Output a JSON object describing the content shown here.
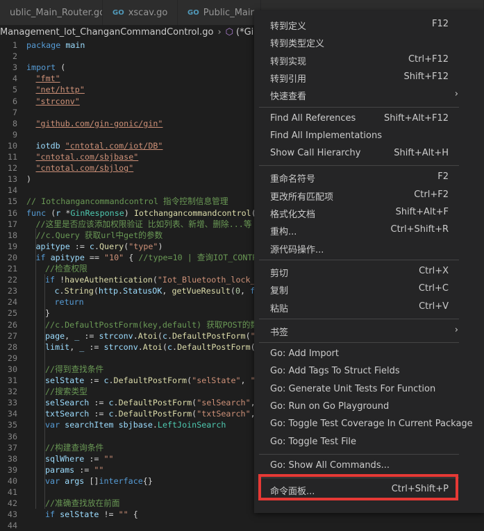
{
  "tabs": [
    {
      "name": "ublic_Main_Router.go",
      "icon": ""
    },
    {
      "name": "xscav.go",
      "icon": "GO"
    },
    {
      "name": "Public_Main_",
      "icon": "GO"
    },
    {
      "name": "",
      "icon": ""
    }
  ],
  "breadcrumb": {
    "file": "Management_lot_ChanganCommandControl.go",
    "symbol": "(*GinR"
  },
  "code_lines": [
    {
      "n": "1",
      "indent": 0,
      "html": "<span class='k'>package</span> <span class='v'>main</span>"
    },
    {
      "n": "2",
      "indent": 0,
      "html": ""
    },
    {
      "n": "3",
      "indent": 0,
      "html": "<span class='k'>import</span> ("
    },
    {
      "n": "4",
      "indent": 1,
      "html": "<span class='s ul'>\"fmt\"</span>"
    },
    {
      "n": "5",
      "indent": 1,
      "html": "<span class='s ul'>\"net/http\"</span>"
    },
    {
      "n": "6",
      "indent": 1,
      "html": "<span class='s ul'>\"strconv\"</span>"
    },
    {
      "n": "7",
      "indent": 0,
      "html": ""
    },
    {
      "n": "8",
      "indent": 1,
      "html": "<span class='s ul'>\"github.com/gin-gonic/gin\"</span>"
    },
    {
      "n": "9",
      "indent": 0,
      "html": ""
    },
    {
      "n": "10",
      "indent": 1,
      "html": "<span class='v'>iotdb</span> <span class='s ul'>\"cntotal.com/iot/DB\"</span>"
    },
    {
      "n": "11",
      "indent": 1,
      "html": "<span class='s ul'>\"cntotal.com/sbjbase\"</span>"
    },
    {
      "n": "12",
      "indent": 1,
      "html": "<span class='s ul'>\"cntotal.com/sbjlog\"</span>"
    },
    {
      "n": "13",
      "indent": 0,
      "html": ")"
    },
    {
      "n": "14",
      "indent": 0,
      "html": ""
    },
    {
      "n": "15",
      "indent": 0,
      "html": "<span class='c'>// Iotchangancommandcontrol 指令控制信息管理</span>"
    },
    {
      "n": "16",
      "indent": 0,
      "html": "<span class='k'>func</span> (<span class='v'>r</span> *<span class='t'>GinResponse</span>) <span class='f'>Iotchangancommandcontrol</span>(<span class='v'>c</span>"
    },
    {
      "n": "17",
      "indent": 1,
      "html": "<span class='c'>//这里是否应该添加权限验证 比如列表、新增、删除...等</span>"
    },
    {
      "n": "18",
      "indent": 1,
      "html": "<span class='c'>//c.Query 获取url中get的参数</span>"
    },
    {
      "n": "19",
      "indent": 1,
      "html": "<span class='v'>apitype</span> := <span class='v'>c</span>.<span class='f'>Query</span>(<span class='s'>\"type\"</span>)"
    },
    {
      "n": "20",
      "indent": 1,
      "html": "<span class='k'>if</span> <span class='v'>apitype</span> == <span class='s'>\"10\"</span> { <span class='c'>//type=10 | 查询IOT_CONTROL</span>"
    },
    {
      "n": "21",
      "indent": 2,
      "html": "<span class='c'>//检查权限</span>"
    },
    {
      "n": "22",
      "indent": 2,
      "html": "<span class='k'>if</span> !<span class='f'>haveAuthentication</span>(<span class='s'>\"Iot_Bluetooth_lock_ma</span>"
    },
    {
      "n": "23",
      "indent": 3,
      "html": "<span class='v'>c</span>.<span class='f'>String</span>(<span class='v'>http</span>.<span class='v'>StatusOK</span>, <span class='f'>getVueResult</span>(<span class='n'>0</span>, <span class='k'>fal</span>"
    },
    {
      "n": "24",
      "indent": 3,
      "html": "<span class='k'>return</span>"
    },
    {
      "n": "25",
      "indent": 2,
      "html": "}"
    },
    {
      "n": "26",
      "indent": 2,
      "html": "<span class='c'>//c.DefaultPostForm(key,default) 获取POST的数据</span>"
    },
    {
      "n": "27",
      "indent": 2,
      "html": "<span class='v'>page</span>, <span class='v'>_</span> := <span class='v'>strconv</span>.<span class='f'>Atoi</span>(<span class='v'>c</span>.<span class='f'>DefaultPostForm</span>(<span class='s'>\"pa</span>"
    },
    {
      "n": "28",
      "indent": 2,
      "html": "<span class='v'>limit</span>, <span class='v'>_</span> := <span class='v'>strconv</span>.<span class='f'>Atoi</span>(<span class='v'>c</span>.<span class='f'>DefaultPostForm</span>(<span class='s'>\"l</span>"
    },
    {
      "n": "29",
      "indent": 0,
      "html": ""
    },
    {
      "n": "30",
      "indent": 2,
      "html": "<span class='c'>//得到查找条件</span>"
    },
    {
      "n": "31",
      "indent": 2,
      "html": "<span class='v'>selState</span> := <span class='v'>c</span>.<span class='f'>DefaultPostForm</span>(<span class='s'>\"selState\"</span>, <span class='s'>\"\"</span>)"
    },
    {
      "n": "32",
      "indent": 2,
      "html": "<span class='c'>//搜索类型</span>"
    },
    {
      "n": "33",
      "indent": 2,
      "html": "<span class='v'>selSearch</span> := <span class='v'>c</span>.<span class='f'>DefaultPostForm</span>(<span class='s'>\"selSearch\"</span>, <span class='s'>\"</span>"
    },
    {
      "n": "34",
      "indent": 2,
      "html": "<span class='v'>txtSearch</span> := <span class='v'>c</span>.<span class='f'>DefaultPostForm</span>(<span class='s'>\"txtSearch\"</span>, <span class='s'>\"</span>"
    },
    {
      "n": "35",
      "indent": 2,
      "html": "<span class='k'>var</span> <span class='v'>searchItem</span> <span class='v'>sbjbase</span>.<span class='t'>LeftJoinSearch</span>"
    },
    {
      "n": "36",
      "indent": 0,
      "html": ""
    },
    {
      "n": "37",
      "indent": 2,
      "html": "<span class='c'>//构建查询条件</span>"
    },
    {
      "n": "38",
      "indent": 2,
      "html": "<span class='v'>sqlWhere</span> := <span class='s'>\"\"</span>"
    },
    {
      "n": "39",
      "indent": 2,
      "html": "<span class='v'>params</span> := <span class='s'>\"\"</span>"
    },
    {
      "n": "40",
      "indent": 2,
      "html": "<span class='k'>var</span> <span class='v'>args</span> []<span class='k'>interface</span>{}"
    },
    {
      "n": "41",
      "indent": 0,
      "html": ""
    },
    {
      "n": "42",
      "indent": 2,
      "html": "<span class='c'>//准确查找放在前面</span>"
    },
    {
      "n": "43",
      "indent": 2,
      "html": "<span class='k'>if</span> <span class='v'>selState</span> != <span class='s'>\"\"</span> {"
    },
    {
      "n": "44",
      "indent": 3,
      "html": ""
    }
  ],
  "right_edge_fragments": [
    "义",
    "20"
  ],
  "menu_groups": [
    [
      {
        "label": "转到定义",
        "key": "F12",
        "submenu": false
      },
      {
        "label": "转到类型定义",
        "key": "",
        "submenu": false
      },
      {
        "label": "转到实现",
        "key": "Ctrl+F12",
        "submenu": false
      },
      {
        "label": "转到引用",
        "key": "Shift+F12",
        "submenu": false
      },
      {
        "label": "快速查看",
        "key": "",
        "submenu": true
      }
    ],
    [
      {
        "label": "Find All References",
        "key": "Shift+Alt+F12",
        "submenu": false
      },
      {
        "label": "Find All Implementations",
        "key": "",
        "submenu": false
      },
      {
        "label": "Show Call Hierarchy",
        "key": "Shift+Alt+H",
        "submenu": false
      }
    ],
    [
      {
        "label": "重命名符号",
        "key": "F2",
        "submenu": false
      },
      {
        "label": "更改所有匹配项",
        "key": "Ctrl+F2",
        "submenu": false
      },
      {
        "label": "格式化文档",
        "key": "Shift+Alt+F",
        "submenu": false
      },
      {
        "label": "重构...",
        "key": "Ctrl+Shift+R",
        "submenu": false
      },
      {
        "label": "源代码操作...",
        "key": "",
        "submenu": false
      }
    ],
    [
      {
        "label": "剪切",
        "key": "Ctrl+X",
        "submenu": false
      },
      {
        "label": "复制",
        "key": "Ctrl+C",
        "submenu": false
      },
      {
        "label": "粘贴",
        "key": "Ctrl+V",
        "submenu": false
      }
    ],
    [
      {
        "label": "书签",
        "key": "",
        "submenu": true
      }
    ],
    [
      {
        "label": "Go: Add Import",
        "key": "",
        "submenu": false
      },
      {
        "label": "Go: Add Tags To Struct Fields",
        "key": "",
        "submenu": false
      },
      {
        "label": "Go: Generate Unit Tests For Function",
        "key": "",
        "submenu": false
      },
      {
        "label": "Go: Run on Go Playground",
        "key": "",
        "submenu": false
      },
      {
        "label": "Go: Toggle Test Coverage In Current Package",
        "key": "",
        "submenu": false
      },
      {
        "label": "Go: Toggle Test File",
        "key": "",
        "submenu": false
      }
    ],
    [
      {
        "label": "Go: Show All Commands...",
        "key": "",
        "submenu": false
      }
    ],
    [
      {
        "label": "命令面板...",
        "key": "Ctrl+Shift+P",
        "submenu": false
      }
    ]
  ],
  "icons": {
    "chevron_right": "›",
    "cube": "⬡"
  },
  "colors": {
    "highlight_border": "#e53935",
    "menu_bg": "#252526",
    "editor_bg": "#1e1e1e"
  }
}
